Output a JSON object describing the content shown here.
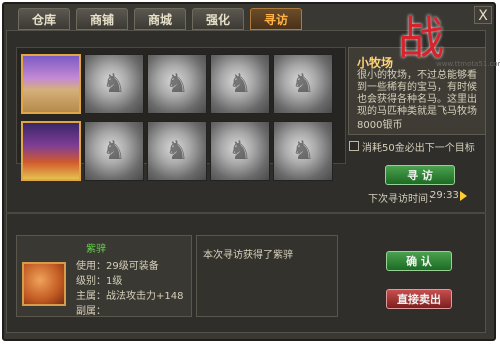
{
  "tabs": [
    {
      "label": "仓库"
    },
    {
      "label": "商铺"
    },
    {
      "label": "商城"
    },
    {
      "label": "强化"
    },
    {
      "label": "寻访"
    }
  ],
  "close_label": "X",
  "selected": {
    "title": "小牧场",
    "description": "很小的牧场，不过总能够看到一些稀有的宝马，有时候也会获得各种名马。这里出现的马匹种类就是飞马牧场",
    "price": "8000银币"
  },
  "checkbox_label": "消耗50金必出下一个目标",
  "search_button": "寻 访",
  "timer": {
    "label": "下次寻访时间：",
    "value": "29:33"
  },
  "horse": {
    "name": "紫骍",
    "use": "使用：29级可装备",
    "level": "级别：1级",
    "main_attr": "主属：战法攻击力+148",
    "sub_attr": "副属："
  },
  "message": "本次寻访获得了紫骍",
  "confirm_button": "确 认",
  "sell_button": "直接卖出",
  "logo": {
    "glyph": "战",
    "url": "www.ttmota51.com"
  },
  "icons": {
    "locked_slot": "locked-horse-icon",
    "play": "play-icon"
  }
}
